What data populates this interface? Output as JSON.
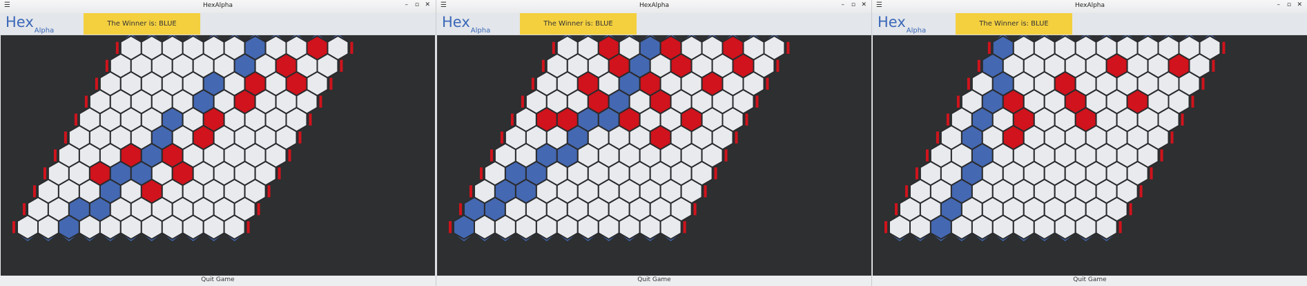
{
  "colors": {
    "blue": "#4468b2",
    "red": "#d0131c",
    "empty": "#e8eaee",
    "board_bg": "#2d2f31",
    "winner_banner": "#f4d03f",
    "logo": "#3b68b8"
  },
  "windows": [
    {
      "title": "HexAlpha",
      "logo": {
        "main": "Hex",
        "sub": "Alpha"
      },
      "winner_text": "The Winner is: BLUE",
      "quit_label": "Quit Game",
      "menu_icon": "hamburger-menu-icon",
      "controls": {
        "minimize": "–",
        "maximize": "▫",
        "close": "✕"
      },
      "board": {
        "size": 11,
        "blue": [
          [
            0,
            6
          ],
          [
            1,
            6
          ],
          [
            2,
            5
          ],
          [
            3,
            5
          ],
          [
            4,
            4
          ],
          [
            5,
            4
          ],
          [
            6,
            4
          ],
          [
            7,
            3
          ],
          [
            7,
            4
          ],
          [
            8,
            3
          ],
          [
            9,
            3
          ],
          [
            9,
            2
          ],
          [
            10,
            2
          ]
        ],
        "red": [
          [
            0,
            9
          ],
          [
            1,
            8
          ],
          [
            2,
            7
          ],
          [
            2,
            9
          ],
          [
            3,
            7
          ],
          [
            4,
            6
          ],
          [
            5,
            6
          ],
          [
            6,
            3
          ],
          [
            6,
            5
          ],
          [
            7,
            2
          ],
          [
            7,
            6
          ],
          [
            8,
            5
          ]
        ]
      }
    },
    {
      "title": "HexAlpha",
      "logo": {
        "main": "Hex",
        "sub": "Alpha"
      },
      "winner_text": "The Winner is: BLUE",
      "quit_label": "Quit Game",
      "menu_icon": "hamburger-menu-icon",
      "controls": {
        "minimize": "–",
        "maximize": "▫",
        "close": "✕"
      },
      "board": {
        "size": 11,
        "blue": [
          [
            0,
            4
          ],
          [
            1,
            4
          ],
          [
            2,
            4
          ],
          [
            3,
            4
          ],
          [
            4,
            3
          ],
          [
            4,
            4
          ],
          [
            5,
            3
          ],
          [
            6,
            2
          ],
          [
            6,
            3
          ],
          [
            7,
            1
          ],
          [
            7,
            2
          ],
          [
            8,
            1
          ],
          [
            8,
            2
          ],
          [
            9,
            0
          ],
          [
            9,
            1
          ],
          [
            10,
            0
          ]
        ],
        "red": [
          [
            0,
            2
          ],
          [
            0,
            5
          ],
          [
            0,
            8
          ],
          [
            1,
            3
          ],
          [
            1,
            6
          ],
          [
            1,
            9
          ],
          [
            2,
            2
          ],
          [
            2,
            5
          ],
          [
            2,
            8
          ],
          [
            3,
            3
          ],
          [
            3,
            6
          ],
          [
            4,
            1
          ],
          [
            4,
            2
          ],
          [
            4,
            5
          ],
          [
            4,
            8
          ],
          [
            5,
            7
          ]
        ]
      }
    },
    {
      "title": "HexAlpha",
      "logo": {
        "main": "Hex",
        "sub": "Alpha"
      },
      "winner_text": "The Winner is: BLUE",
      "quit_label": "Quit Game",
      "menu_icon": "hamburger-menu-icon",
      "controls": {
        "minimize": "–",
        "maximize": "▫",
        "close": "✕"
      },
      "board": {
        "size": 11,
        "blue": [
          [
            0,
            0
          ],
          [
            1,
            0
          ],
          [
            2,
            1
          ],
          [
            3,
            1
          ],
          [
            4,
            1
          ],
          [
            5,
            1
          ],
          [
            6,
            2
          ],
          [
            7,
            2
          ],
          [
            8,
            2
          ],
          [
            9,
            2
          ],
          [
            10,
            2
          ]
        ],
        "red": [
          [
            1,
            6
          ],
          [
            1,
            9
          ],
          [
            2,
            4
          ],
          [
            3,
            2
          ],
          [
            3,
            5
          ],
          [
            3,
            8
          ],
          [
            4,
            3
          ],
          [
            4,
            6
          ],
          [
            5,
            3
          ]
        ]
      }
    }
  ]
}
